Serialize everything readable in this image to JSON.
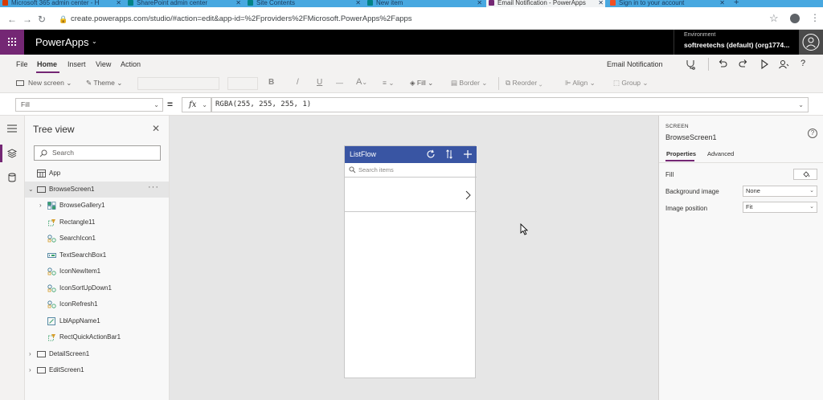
{
  "browser": {
    "tabs": [
      {
        "title": "Microsoft 365 admin center - H",
        "favicon_color": "#d83b01"
      },
      {
        "title": "SharePoint admin center",
        "favicon_color": "#038387"
      },
      {
        "title": "Site Contents",
        "favicon_color": "#038387"
      },
      {
        "title": "New item",
        "favicon_color": "#038387"
      },
      {
        "title": "Email Notification - PowerApps",
        "favicon_color": "#742774"
      },
      {
        "title": "Sign in to your account",
        "favicon_color": "#f25022"
      }
    ],
    "new_tab": "+",
    "url": "create.powerapps.com/studio/#action=edit&app-id=%2Fproviders%2FMicrosoft.PowerApps%2Fapps"
  },
  "header": {
    "app_name": "PowerApps",
    "env_label": "Environment",
    "env_name": "softreetechs (default) (org1774..."
  },
  "menu": {
    "items": [
      "File",
      "Home",
      "Insert",
      "View",
      "Action"
    ],
    "active": "Home",
    "app_title": "Email Notification",
    "right_icons": [
      "app-checker-icon",
      "undo-icon",
      "redo-icon",
      "play-icon",
      "share-icon",
      "help-icon"
    ]
  },
  "toolbar": {
    "new_screen": "New screen",
    "theme": "Theme",
    "bold": "B",
    "italic": "/",
    "underline": "U",
    "strike": "—",
    "font_color": "A",
    "fill": "Fill",
    "border": "Border",
    "reorder": "Reorder",
    "align": "Align",
    "group": "Group"
  },
  "formula_bar": {
    "property": "Fill",
    "equals": "=",
    "fx": "fx",
    "formula": "RGBA(255, 255, 255, 1)"
  },
  "tree": {
    "title": "Tree view",
    "search_placeholder": "Search",
    "nodes": [
      {
        "label": "App",
        "level": 0,
        "icon": "app-icon"
      },
      {
        "label": "BrowseScreen1",
        "level": 0,
        "icon": "screen-icon",
        "expanded": true,
        "selected": true
      },
      {
        "label": "BrowseGallery1",
        "level": 1,
        "icon": "gallery-icon",
        "collapsed": true
      },
      {
        "label": "Rectangle11",
        "level": 1,
        "icon": "rectangle-icon"
      },
      {
        "label": "SearchIcon1",
        "level": 1,
        "icon": "icon-control-icon"
      },
      {
        "label": "TextSearchBox1",
        "level": 1,
        "icon": "textinput-icon"
      },
      {
        "label": "IconNewItem1",
        "level": 1,
        "icon": "icon-control-icon"
      },
      {
        "label": "IconSortUpDown1",
        "level": 1,
        "icon": "icon-control-icon"
      },
      {
        "label": "IconRefresh1",
        "level": 1,
        "icon": "icon-control-icon"
      },
      {
        "label": "LblAppName1",
        "level": 1,
        "icon": "label-icon"
      },
      {
        "label": "RectQuickActionBar1",
        "level": 1,
        "icon": "rectangle-icon"
      },
      {
        "label": "DetailScreen1",
        "level": 0,
        "icon": "screen-icon",
        "collapsed": true
      },
      {
        "label": "EditScreen1",
        "level": 0,
        "icon": "screen-icon",
        "collapsed": true
      }
    ]
  },
  "canvas_app": {
    "title": "ListFlow",
    "header_color": "#3955a3",
    "search_placeholder": "Search items"
  },
  "properties": {
    "type_label": "SCREEN",
    "screen_name": "BrowseScreen1",
    "help": "?",
    "tabs": [
      "Properties",
      "Advanced"
    ],
    "active_tab": "Properties",
    "rows": [
      {
        "label": "Fill",
        "value": ""
      },
      {
        "label": "Background image",
        "value": "None"
      },
      {
        "label": "Image position",
        "value": "Fit"
      }
    ]
  },
  "colors": {
    "accent": "#742774",
    "canvas_bg": "#e6e6e6",
    "tab_strip": "#48a8e0"
  }
}
